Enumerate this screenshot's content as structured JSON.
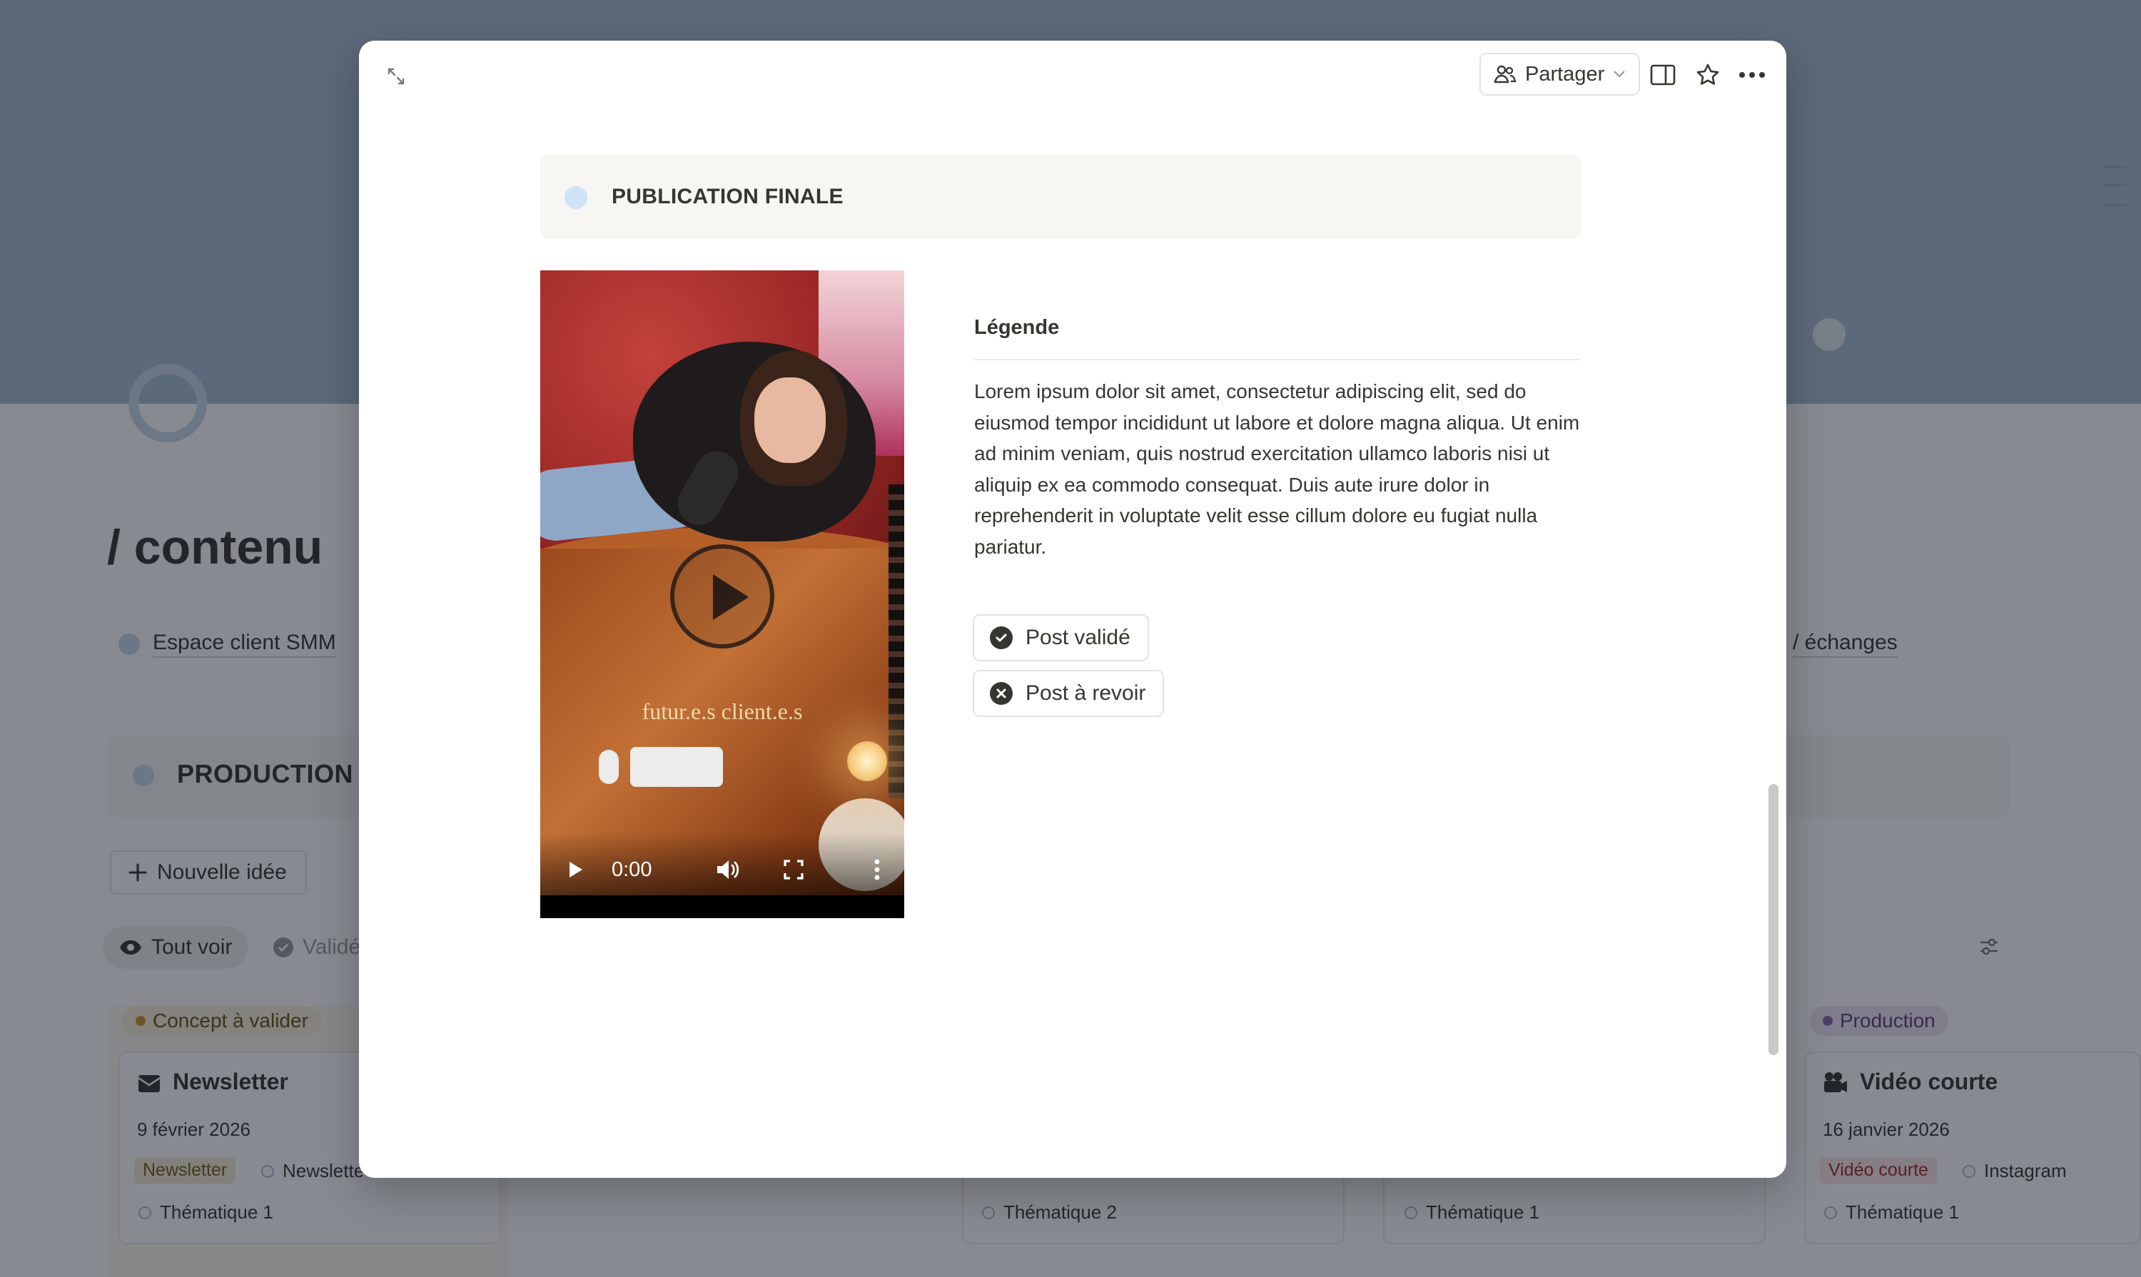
{
  "background": {
    "page_title": "/ contenu",
    "links": {
      "left": "Espace client SMM",
      "right": "/ échanges"
    },
    "section": "PRODUCTION",
    "new_button": "Nouvelle idée",
    "filters": {
      "all": "Tout voir",
      "validated": "Validé"
    },
    "columns": [
      {
        "status": "Concept à valider",
        "status_color": "#cb912f",
        "card": {
          "title": "Newsletter",
          "date": "9 février 2026",
          "chip": "Newsletter",
          "channel": "Newslette",
          "theme": "Thématique 1"
        }
      },
      {
        "theme": "Thématique 2"
      },
      {
        "theme": "Thématique 1"
      },
      {
        "status": "Production",
        "status_color": "#9065b0",
        "card": {
          "title": "Vidéo courte",
          "date": "16 janvier 2026",
          "chip": "Vidéo courte",
          "channel": "Instagram",
          "theme": "Thématique 1"
        }
      }
    ]
  },
  "modal": {
    "toolbar": {
      "expand_icon": "expand-diagonal-icon",
      "share_label": "Partager",
      "share_icon": "people-icon",
      "panel_icon": "side-panel-icon",
      "favorite_icon": "star-icon",
      "more_icon": "ellipsis-icon"
    },
    "callout": "PUBLICATION FINALE",
    "video": {
      "overlay_text": "futur.e.s client.e.s",
      "time": "0:00",
      "progress": 0
    },
    "caption": {
      "title": "Légende",
      "body": "Lorem ipsum dolor sit amet, consectetur adipiscing elit, sed do eiusmod tempor incididunt ut labore et dolore magna aliqua. Ut enim ad minim veniam, quis nostrud exercitation ullamco laboris nisi ut aliquip ex ea commodo consequat. Duis aute irure dolor in reprehenderit in voluptate velit esse cillum dolore eu fugiat nulla pariatur."
    },
    "actions": {
      "approve": "Post validé",
      "revise": "Post à revoir"
    }
  }
}
